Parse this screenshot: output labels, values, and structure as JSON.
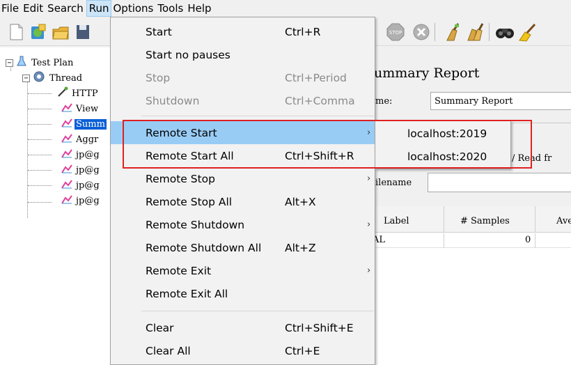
{
  "menubar": {
    "items": [
      "File",
      "Edit",
      "Search",
      "Run",
      "Options",
      "Tools",
      "Help"
    ]
  },
  "toolbar": {
    "icons": [
      "new-icon",
      "templates-icon",
      "open-icon",
      "save-icon",
      "stop-icon",
      "shutdown-icon",
      "clear-icon",
      "clear-all-icon",
      "search-icon",
      "reset-search-icon"
    ]
  },
  "tree": {
    "items": [
      {
        "label": "Test Plan"
      },
      {
        "label": "Thread"
      },
      {
        "label": "HTTP"
      },
      {
        "label": "View"
      },
      {
        "label": "Summ"
      },
      {
        "label": "Aggr"
      },
      {
        "label": "jp@g"
      },
      {
        "label": "jp@g"
      },
      {
        "label": "jp@g"
      },
      {
        "label": "jp@g"
      }
    ]
  },
  "right_pane": {
    "title": "ummary Report",
    "name_label": "me:",
    "name_value": "Summary Report",
    "read_from_label": "/ Read fr",
    "filename_label": "ilename",
    "table": {
      "headers": [
        "Label",
        "# Samples",
        "Ave"
      ],
      "rows": [
        [
          "AL",
          "0",
          ""
        ]
      ]
    }
  },
  "run_menu": {
    "items": [
      {
        "label": "Start",
        "shortcut": "Ctrl+R"
      },
      {
        "label": "Start no pauses",
        "shortcut": ""
      },
      {
        "label": "Stop",
        "shortcut": "Ctrl+Period"
      },
      {
        "label": "Shutdown",
        "shortcut": "Ctrl+Comma"
      },
      {
        "label": "Remote Start",
        "shortcut": ""
      },
      {
        "label": "Remote Start All",
        "shortcut": "Ctrl+Shift+R"
      },
      {
        "label": "Remote Stop",
        "shortcut": ""
      },
      {
        "label": "Remote Stop All",
        "shortcut": "Alt+X"
      },
      {
        "label": "Remote Shutdown",
        "shortcut": ""
      },
      {
        "label": "Remote Shutdown All",
        "shortcut": "Alt+Z"
      },
      {
        "label": "Remote Exit",
        "shortcut": ""
      },
      {
        "label": "Remote Exit All",
        "shortcut": ""
      },
      {
        "label": "Clear",
        "shortcut": "Ctrl+Shift+E"
      },
      {
        "label": "Clear All",
        "shortcut": "Ctrl+E"
      }
    ]
  },
  "remote_start_submenu": {
    "items": [
      "localhost:2019",
      "localhost:2020"
    ]
  },
  "colors": {
    "menu_hover": "#99ccf5",
    "selection": "#0b5fd7",
    "highlight_box": "#e02020"
  }
}
